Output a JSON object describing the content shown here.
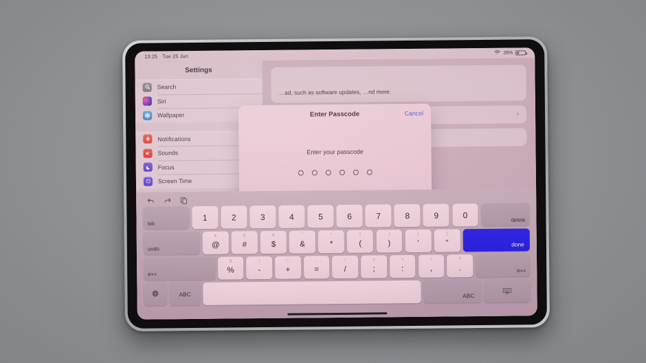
{
  "device": {
    "kind": "tablet"
  },
  "status_bar": {
    "time": "13:25",
    "date": "Tue 25 Jun",
    "wifi_icon": "wifi-icon",
    "battery_percent": "26%",
    "battery_icon": "battery-icon"
  },
  "settings": {
    "sidebar": {
      "title": "Settings",
      "groups": [
        {
          "items": [
            {
              "label": "Search",
              "icon": "search-icon",
              "key": "search"
            },
            {
              "label": "Siri",
              "icon": "siri-icon",
              "key": "siri"
            },
            {
              "label": "Wallpaper",
              "icon": "wallpaper-icon",
              "key": "wallpaper"
            }
          ]
        },
        {
          "items": [
            {
              "label": "Notifications",
              "icon": "bell-icon",
              "key": "notifications"
            },
            {
              "label": "Sounds",
              "icon": "speaker-icon",
              "key": "sounds"
            },
            {
              "label": "Focus",
              "icon": "moon-icon",
              "key": "focus"
            },
            {
              "label": "Screen Time",
              "icon": "hourglass-icon",
              "key": "screentime"
            }
          ]
        }
      ]
    },
    "content": {
      "description": "…ad, such as software updates, …nd more.",
      "row_chevron": "›"
    }
  },
  "dialog": {
    "title": "Enter Passcode",
    "cancel_label": "Cancel",
    "prompt": "Enter your passcode",
    "dot_count": 6,
    "cancel_color": "#4b4fd6"
  },
  "keyboard": {
    "toolbar": [
      {
        "name": "undo-icon"
      },
      {
        "name": "redo-icon"
      },
      {
        "name": "paste-icon"
      }
    ],
    "rows": [
      [
        {
          "type": "mod-left",
          "primary": "tab",
          "name": "tab-key",
          "flex": "tab"
        },
        {
          "type": "key",
          "primary": "1",
          "name": "key-1"
        },
        {
          "type": "key",
          "primary": "2",
          "name": "key-2"
        },
        {
          "type": "key",
          "primary": "3",
          "name": "key-3"
        },
        {
          "type": "key",
          "primary": "4",
          "name": "key-4"
        },
        {
          "type": "key",
          "primary": "5",
          "name": "key-5"
        },
        {
          "type": "key",
          "primary": "6",
          "name": "key-6"
        },
        {
          "type": "key",
          "primary": "7",
          "name": "key-7"
        },
        {
          "type": "key",
          "primary": "8",
          "name": "key-8"
        },
        {
          "type": "key",
          "primary": "9",
          "name": "key-9"
        },
        {
          "type": "key",
          "primary": "0",
          "name": "key-0"
        },
        {
          "type": "mod-right",
          "primary": "delete",
          "name": "delete-key",
          "flex": "delete"
        }
      ],
      [
        {
          "type": "mod-left",
          "primary": "undo",
          "name": "undo-key",
          "flex": "undo"
        },
        {
          "type": "key",
          "primary": "@",
          "secondary": "¢",
          "name": "key-at"
        },
        {
          "type": "key",
          "primary": "#",
          "secondary": "£",
          "name": "key-hash"
        },
        {
          "type": "key",
          "primary": "$",
          "secondary": "¥",
          "name": "key-dollar"
        },
        {
          "type": "key",
          "primary": "&",
          "secondary": "¯",
          "name": "key-ampersand"
        },
        {
          "type": "key",
          "primary": "*",
          "secondary": "^",
          "name": "key-asterisk"
        },
        {
          "type": "key",
          "primary": "(",
          "secondary": "[",
          "name": "key-paren-open"
        },
        {
          "type": "key",
          "primary": ")",
          "secondary": "]",
          "name": "key-paren-close"
        },
        {
          "type": "key",
          "primary": "‘",
          "secondary": "{",
          "name": "key-quote-single"
        },
        {
          "type": "key",
          "primary": "“",
          "secondary": "}",
          "name": "key-quote-double"
        },
        {
          "type": "done",
          "primary": "done",
          "name": "done-key",
          "flex": "done-k"
        }
      ],
      [
        {
          "type": "mod-left",
          "primary": "#+=",
          "name": "symbols-key-left",
          "flex": "sym-l"
        },
        {
          "type": "key",
          "primary": "%",
          "secondary": "§",
          "name": "key-percent"
        },
        {
          "type": "key",
          "primary": "-",
          "secondary": "|",
          "name": "key-hyphen"
        },
        {
          "type": "key",
          "primary": "+",
          "secondary": "~",
          "name": "key-plus"
        },
        {
          "type": "key",
          "primary": "=",
          "secondary": "…",
          "name": "key-equals"
        },
        {
          "type": "key",
          "primary": "/",
          "secondary": "\\",
          "name": "key-slash"
        },
        {
          "type": "key",
          "primary": ";",
          "secondary": "<",
          "name": "key-semicolon"
        },
        {
          "type": "key",
          "primary": ":",
          "secondary": ">",
          "name": "key-colon"
        },
        {
          "type": "key",
          "primary": ",",
          "secondary": "!",
          "name": "key-comma"
        },
        {
          "type": "key",
          "primary": ".",
          "secondary": "?",
          "name": "key-period"
        },
        {
          "type": "mod-right",
          "primary": "#+=",
          "name": "symbols-key-right",
          "flex": "sym-r"
        }
      ],
      [
        {
          "type": "icon",
          "icon": "globe-icon",
          "name": "globe-key",
          "flex": "globe"
        },
        {
          "type": "mod",
          "primary": "ABC",
          "name": "abc-key-left",
          "flex": "abc-l"
        },
        {
          "type": "space",
          "primary": "",
          "name": "space-key",
          "flex": "space"
        },
        {
          "type": "mod",
          "primary": "ABC",
          "name": "abc-key-right",
          "flex": "abc-r"
        },
        {
          "type": "icon",
          "icon": "dismiss-keyboard-icon",
          "name": "dismiss-keyboard-key",
          "flex": "kbd"
        }
      ]
    ],
    "done_key_color": "#1f18ef"
  }
}
